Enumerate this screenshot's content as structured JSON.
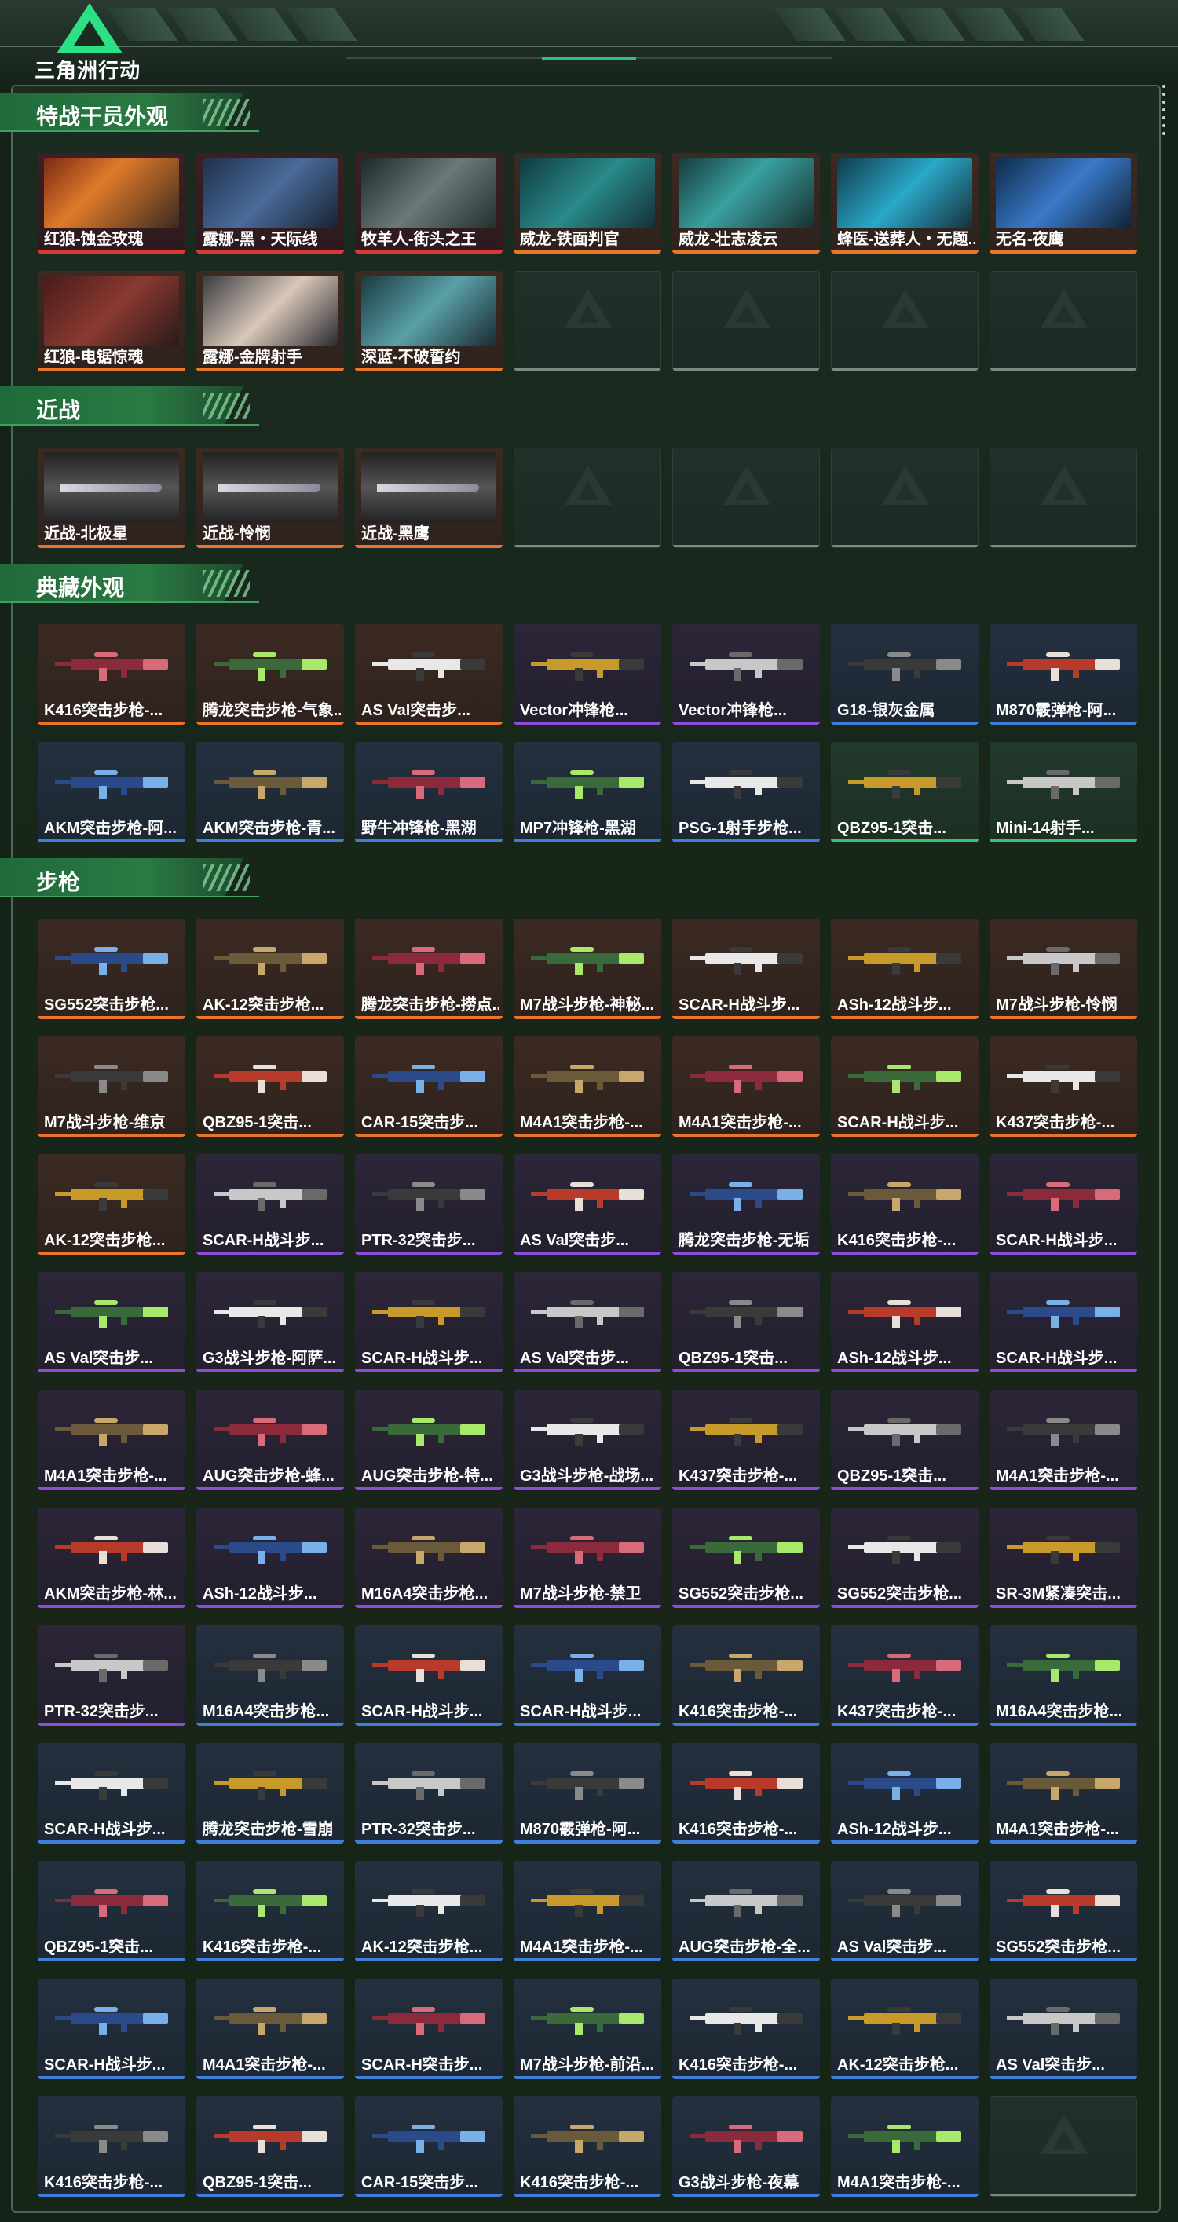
{
  "header": {
    "logo_text": "三角洲行动"
  },
  "colors": {
    "orange": "#e8752a",
    "purple": "#8a4ed8",
    "blue": "#3f7fd8",
    "green": "#36c07a",
    "accent": "#2ce085"
  },
  "sections": [
    {
      "title": "特战干员外观",
      "items": [
        {
          "name": "红狼-蚀金玫瑰",
          "rarity": "red",
          "kind": "photo"
        },
        {
          "name": "露娜-黑・天际线",
          "rarity": "red",
          "kind": "photo"
        },
        {
          "name": "牧羊人-街头之王",
          "rarity": "red",
          "kind": "photo"
        },
        {
          "name": "威龙-铁面判官",
          "rarity": "orange",
          "kind": "photo"
        },
        {
          "name": "威龙-壮志凌云",
          "rarity": "orange",
          "kind": "photo"
        },
        {
          "name": "蜂医-送葬人・无题...",
          "rarity": "orange",
          "kind": "photo"
        },
        {
          "name": "无名-夜鹰",
          "rarity": "orange",
          "kind": "photo"
        },
        {
          "name": "红狼-电锯惊魂",
          "rarity": "orange",
          "kind": "photo"
        },
        {
          "name": "露娜-金牌射手",
          "rarity": "orange",
          "kind": "photo"
        },
        {
          "name": "深蓝-不破誓约",
          "rarity": "orange",
          "kind": "photo"
        },
        {
          "name": "",
          "rarity": "empty",
          "kind": "empty"
        },
        {
          "name": "",
          "rarity": "empty",
          "kind": "empty"
        },
        {
          "name": "",
          "rarity": "empty",
          "kind": "empty"
        },
        {
          "name": "",
          "rarity": "empty",
          "kind": "empty"
        }
      ]
    },
    {
      "title": "近战",
      "items": [
        {
          "name": "近战-北极星",
          "rarity": "orange",
          "kind": "knife"
        },
        {
          "name": "近战-怜悯",
          "rarity": "orange",
          "kind": "knife"
        },
        {
          "name": "近战-黑鹰",
          "rarity": "orange",
          "kind": "knife"
        },
        {
          "name": "",
          "rarity": "empty",
          "kind": "empty"
        },
        {
          "name": "",
          "rarity": "empty",
          "kind": "empty"
        },
        {
          "name": "",
          "rarity": "empty",
          "kind": "empty"
        },
        {
          "name": "",
          "rarity": "empty",
          "kind": "empty"
        }
      ]
    },
    {
      "title": "典藏外观",
      "items": [
        {
          "name": "K416突击步枪-...",
          "rarity": "orange",
          "kind": "gun"
        },
        {
          "name": "腾龙突击步枪-气象...",
          "rarity": "orange",
          "kind": "gun"
        },
        {
          "name": "AS Val突击步...",
          "rarity": "orange",
          "kind": "gun"
        },
        {
          "name": "Vector冲锋枪...",
          "rarity": "purple",
          "kind": "gun"
        },
        {
          "name": "Vector冲锋枪...",
          "rarity": "purple",
          "kind": "gun"
        },
        {
          "name": "G18-银灰金属",
          "rarity": "blue",
          "kind": "gun"
        },
        {
          "name": "M870霰弹枪-阿...",
          "rarity": "blue",
          "kind": "gun"
        },
        {
          "name": "AKM突击步枪-阿...",
          "rarity": "blue",
          "kind": "gun"
        },
        {
          "name": "AKM突击步枪-青...",
          "rarity": "blue",
          "kind": "gun"
        },
        {
          "name": "野牛冲锋枪-黑湖",
          "rarity": "blue",
          "kind": "gun"
        },
        {
          "name": "MP7冲锋枪-黑湖",
          "rarity": "blue",
          "kind": "gun"
        },
        {
          "name": "PSG-1射手步枪...",
          "rarity": "blue",
          "kind": "gun"
        },
        {
          "name": "QBZ95-1突击...",
          "rarity": "green",
          "kind": "gun"
        },
        {
          "name": "Mini-14射手...",
          "rarity": "green",
          "kind": "gun"
        }
      ]
    },
    {
      "title": "步枪",
      "items": [
        {
          "name": "SG552突击步枪...",
          "rarity": "orange",
          "kind": "gun"
        },
        {
          "name": "AK-12突击步枪...",
          "rarity": "orange",
          "kind": "gun"
        },
        {
          "name": "腾龙突击步枪-捞点...",
          "rarity": "orange",
          "kind": "gun"
        },
        {
          "name": "M7战斗步枪-神秘...",
          "rarity": "orange",
          "kind": "gun"
        },
        {
          "name": "SCAR-H战斗步...",
          "rarity": "orange",
          "kind": "gun"
        },
        {
          "name": "ASh-12战斗步...",
          "rarity": "orange",
          "kind": "gun"
        },
        {
          "name": "M7战斗步枪-怜悯",
          "rarity": "orange",
          "kind": "gun"
        },
        {
          "name": "M7战斗步枪-维京",
          "rarity": "orange",
          "kind": "gun"
        },
        {
          "name": "QBZ95-1突击...",
          "rarity": "orange",
          "kind": "gun"
        },
        {
          "name": "CAR-15突击步...",
          "rarity": "orange",
          "kind": "gun"
        },
        {
          "name": "M4A1突击步枪-...",
          "rarity": "orange",
          "kind": "gun"
        },
        {
          "name": "M4A1突击步枪-...",
          "rarity": "orange",
          "kind": "gun"
        },
        {
          "name": "SCAR-H战斗步...",
          "rarity": "orange",
          "kind": "gun"
        },
        {
          "name": "K437突击步枪-...",
          "rarity": "orange",
          "kind": "gun"
        },
        {
          "name": "AK-12突击步枪...",
          "rarity": "orange",
          "kind": "gun"
        },
        {
          "name": "SCAR-H战斗步...",
          "rarity": "purple",
          "kind": "gun"
        },
        {
          "name": "PTR-32突击步...",
          "rarity": "purple",
          "kind": "gun"
        },
        {
          "name": "AS Val突击步...",
          "rarity": "purple",
          "kind": "gun"
        },
        {
          "name": "腾龙突击步枪-无垢",
          "rarity": "purple",
          "kind": "gun"
        },
        {
          "name": "K416突击步枪-...",
          "rarity": "purple",
          "kind": "gun"
        },
        {
          "name": "SCAR-H战斗步...",
          "rarity": "purple",
          "kind": "gun"
        },
        {
          "name": "AS Val突击步...",
          "rarity": "purple",
          "kind": "gun"
        },
        {
          "name": "G3战斗步枪-阿萨...",
          "rarity": "purple",
          "kind": "gun"
        },
        {
          "name": "SCAR-H战斗步...",
          "rarity": "purple",
          "kind": "gun"
        },
        {
          "name": "AS Val突击步...",
          "rarity": "purple",
          "kind": "gun"
        },
        {
          "name": "QBZ95-1突击...",
          "rarity": "purple",
          "kind": "gun"
        },
        {
          "name": "ASh-12战斗步...",
          "rarity": "purple",
          "kind": "gun"
        },
        {
          "name": "SCAR-H战斗步...",
          "rarity": "purple",
          "kind": "gun"
        },
        {
          "name": "M4A1突击步枪-...",
          "rarity": "purple",
          "kind": "gun"
        },
        {
          "name": "AUG突击步枪-蜂...",
          "rarity": "purple",
          "kind": "gun"
        },
        {
          "name": "AUG突击步枪-特...",
          "rarity": "purple",
          "kind": "gun"
        },
        {
          "name": "G3战斗步枪-战场...",
          "rarity": "purple",
          "kind": "gun"
        },
        {
          "name": "K437突击步枪-...",
          "rarity": "purple",
          "kind": "gun"
        },
        {
          "name": "QBZ95-1突击...",
          "rarity": "purple",
          "kind": "gun"
        },
        {
          "name": "M4A1突击步枪-...",
          "rarity": "purple",
          "kind": "gun"
        },
        {
          "name": "AKM突击步枪-林...",
          "rarity": "purple",
          "kind": "gun"
        },
        {
          "name": "ASh-12战斗步...",
          "rarity": "purple",
          "kind": "gun"
        },
        {
          "name": "M16A4突击步枪...",
          "rarity": "purple",
          "kind": "gun"
        },
        {
          "name": "M7战斗步枪-禁卫",
          "rarity": "purple",
          "kind": "gun"
        },
        {
          "name": "SG552突击步枪...",
          "rarity": "purple",
          "kind": "gun"
        },
        {
          "name": "SG552突击步枪...",
          "rarity": "purple",
          "kind": "gun"
        },
        {
          "name": "SR-3M紧凑突击...",
          "rarity": "purple",
          "kind": "gun"
        },
        {
          "name": "PTR-32突击步...",
          "rarity": "purple",
          "kind": "gun"
        },
        {
          "name": "M16A4突击步枪...",
          "rarity": "blue",
          "kind": "gun"
        },
        {
          "name": "SCAR-H战斗步...",
          "rarity": "blue",
          "kind": "gun"
        },
        {
          "name": "SCAR-H战斗步...",
          "rarity": "blue",
          "kind": "gun"
        },
        {
          "name": "K416突击步枪-...",
          "rarity": "blue",
          "kind": "gun"
        },
        {
          "name": "K437突击步枪-...",
          "rarity": "blue",
          "kind": "gun"
        },
        {
          "name": "M16A4突击步枪...",
          "rarity": "blue",
          "kind": "gun"
        },
        {
          "name": "SCAR-H战斗步...",
          "rarity": "blue",
          "kind": "gun"
        },
        {
          "name": "腾龙突击步枪-雪崩",
          "rarity": "blue",
          "kind": "gun"
        },
        {
          "name": "PTR-32突击步...",
          "rarity": "blue",
          "kind": "gun"
        },
        {
          "name": "M870霰弹枪-阿...",
          "rarity": "blue",
          "kind": "gun"
        },
        {
          "name": "K416突击步枪-...",
          "rarity": "blue",
          "kind": "gun"
        },
        {
          "name": "ASh-12战斗步...",
          "rarity": "blue",
          "kind": "gun"
        },
        {
          "name": "M4A1突击步枪-...",
          "rarity": "blue",
          "kind": "gun"
        },
        {
          "name": "QBZ95-1突击...",
          "rarity": "blue",
          "kind": "gun"
        },
        {
          "name": "K416突击步枪-...",
          "rarity": "blue",
          "kind": "gun"
        },
        {
          "name": "AK-12突击步枪...",
          "rarity": "blue",
          "kind": "gun"
        },
        {
          "name": "M4A1突击步枪-...",
          "rarity": "blue",
          "kind": "gun"
        },
        {
          "name": "AUG突击步枪-全...",
          "rarity": "blue",
          "kind": "gun"
        },
        {
          "name": "AS Val突击步...",
          "rarity": "blue",
          "kind": "gun"
        },
        {
          "name": "SG552突击步枪...",
          "rarity": "blue",
          "kind": "gun"
        },
        {
          "name": "SCAR-H战斗步...",
          "rarity": "blue",
          "kind": "gun"
        },
        {
          "name": "M4A1突击步枪-...",
          "rarity": "blue",
          "kind": "gun"
        },
        {
          "name": "SCAR-H突击步...",
          "rarity": "blue",
          "kind": "gun"
        },
        {
          "name": "M7战斗步枪-前沿...",
          "rarity": "blue",
          "kind": "gun"
        },
        {
          "name": "K416突击步枪-...",
          "rarity": "blue",
          "kind": "gun"
        },
        {
          "name": "AK-12突击步枪...",
          "rarity": "blue",
          "kind": "gun"
        },
        {
          "name": "AS Val突击步...",
          "rarity": "blue",
          "kind": "gun"
        },
        {
          "name": "K416突击步枪-...",
          "rarity": "blue",
          "kind": "gun"
        },
        {
          "name": "QBZ95-1突击...",
          "rarity": "blue",
          "kind": "gun"
        },
        {
          "name": "CAR-15突击步...",
          "rarity": "blue",
          "kind": "gun"
        },
        {
          "name": "K416突击步枪-...",
          "rarity": "blue",
          "kind": "gun"
        },
        {
          "name": "G3战斗步枪-夜幕",
          "rarity": "blue",
          "kind": "gun"
        },
        {
          "name": "M4A1突击步枪-...",
          "rarity": "blue",
          "kind": "gun"
        },
        {
          "name": "",
          "rarity": "empty",
          "kind": "empty"
        }
      ]
    }
  ]
}
